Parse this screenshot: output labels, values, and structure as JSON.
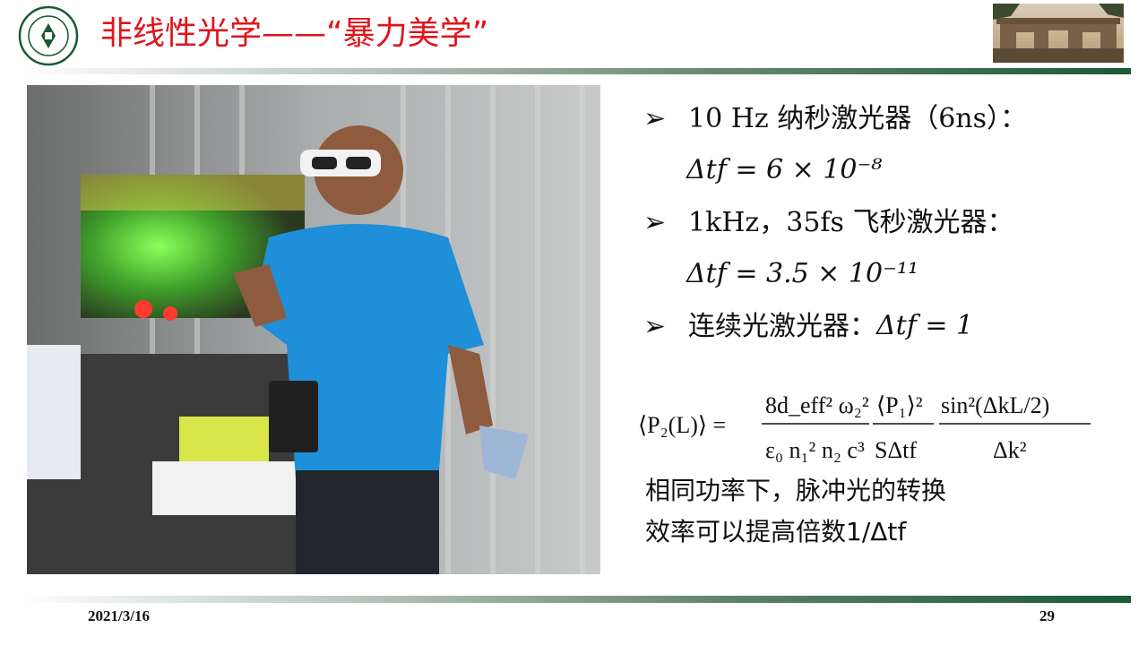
{
  "header": {
    "title": "非线性光学——“暴力美学”",
    "logo_text": "中山大學",
    "logo_ring_text": "SUN YAT-SEN UNIVERSITY"
  },
  "bullets": [
    {
      "label": "10 Hz  纳秒激光器（6ns）：",
      "formula": "Δtf = 6 × 10⁻⁸"
    },
    {
      "label": "1kHz，35fs 飞秒激光器：",
      "formula": "Δtf = 3.5 × 10⁻¹¹"
    },
    {
      "label": "连续光激光器：",
      "formula": "Δtf = 1"
    }
  ],
  "equation": {
    "lhs": "⟨P₂(L)⟩ =",
    "frac1_num": "8d_eff² ω₂²",
    "frac1_den": "ε₀ n₁² n₂ c³",
    "frac2_num": "⟨P₁⟩²",
    "frac2_den": "SΔtf",
    "frac3_num": "sin²(ΔkL/2)",
    "frac3_den": "Δk²"
  },
  "conclusion": {
    "line1": "相同功率下，脉冲光的转换",
    "line2": "效率可以提高倍数1/Δtf"
  },
  "footer": {
    "date": "2021/3/16",
    "page": "29"
  },
  "colors": {
    "title": "#e0141c",
    "brand_green": "#1a5a34"
  }
}
